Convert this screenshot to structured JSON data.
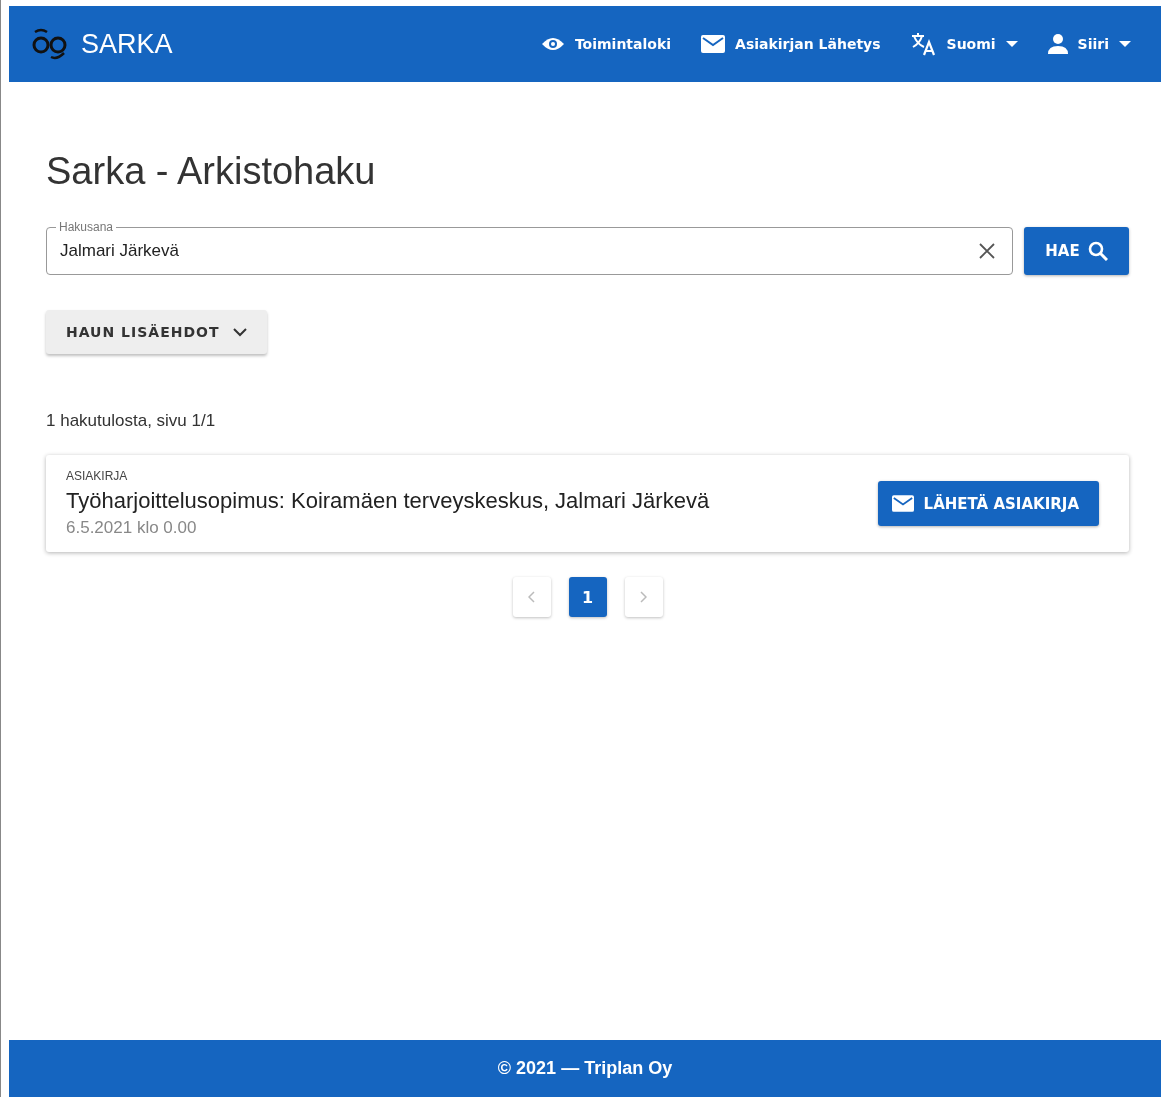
{
  "header": {
    "logo_text": "SARKA",
    "nav": [
      {
        "kind": "eye",
        "label": "Toimintaloki",
        "dropdown": false
      },
      {
        "kind": "mail",
        "label": "Asiakirjan Lähetys",
        "dropdown": false
      },
      {
        "kind": "translate",
        "label": "Suomi",
        "dropdown": true
      },
      {
        "kind": "user",
        "label": "Siiri",
        "dropdown": true
      }
    ]
  },
  "page_title": "Sarka - Arkistohaku",
  "search": {
    "label": "Hakusana",
    "value": "Jalmari Järkevä",
    "button": "HAE"
  },
  "more_filters": {
    "label": "HAUN LISÄEHDOT",
    "expanded": false
  },
  "result_count": "1 hakutulosta, sivu 1/1",
  "results": [
    {
      "type": "ASIAKIRJA",
      "title": "Työharjoittelusopimus: Koiramäen terveyskeskus, Jalmari Järkevä",
      "date": "6.5.2021 klo 0.00",
      "button": "LÄHETÄ ASIAKIRJA"
    }
  ],
  "pagination": {
    "prev_disabled": true,
    "next_disabled": true,
    "pages": [
      {
        "label": "1",
        "selected": true
      }
    ]
  },
  "footer": "© 2021 — Triplan Oy"
}
